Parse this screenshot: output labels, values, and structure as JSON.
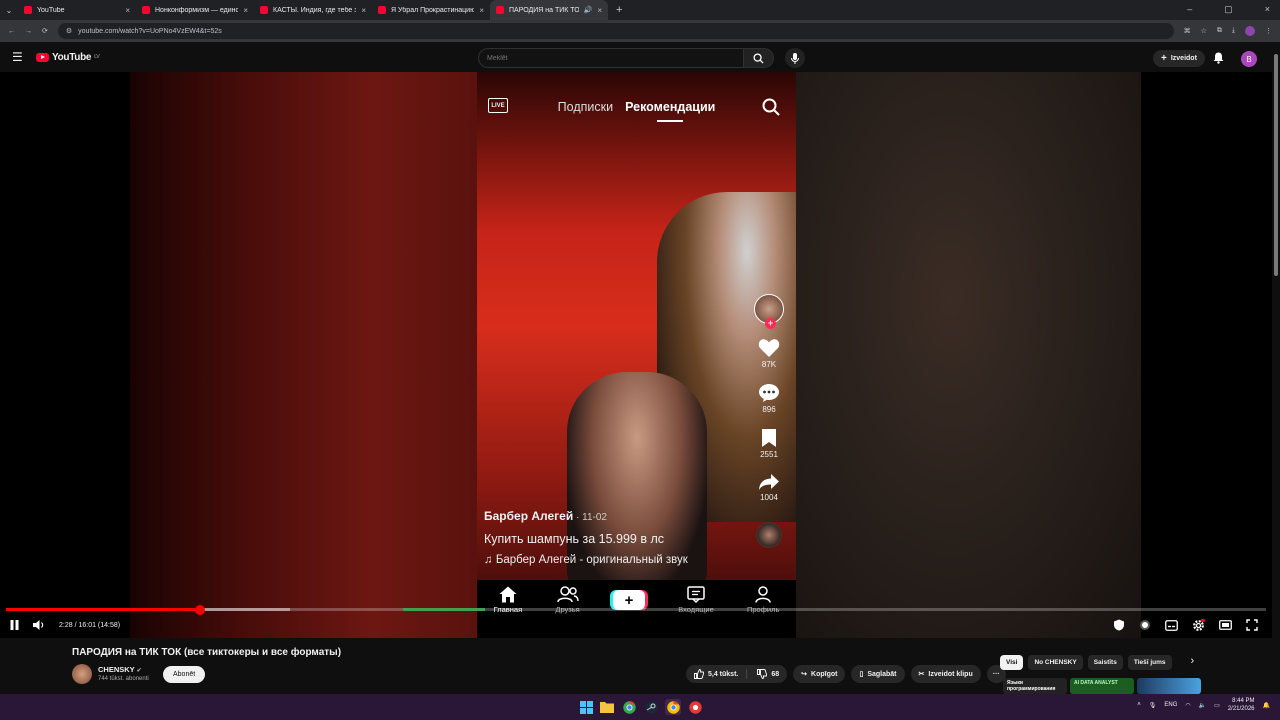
{
  "browser": {
    "tabs": [
      {
        "title": "YouTube",
        "close": "×"
      },
      {
        "title": "Нонконформизм — единств",
        "close": "×"
      },
      {
        "title": "КАСТЫ. Индия, где тебе запре",
        "close": "×"
      },
      {
        "title": "Я Убрал Прокрастинацию На",
        "close": "×"
      },
      {
        "title": "ПАРОДИЯ на ТИК ТОК (в",
        "close": "×"
      }
    ],
    "new_tab": "+",
    "url": "youtube.com/watch?v=UoPNo4VzEW4&t=52s",
    "window_controls": [
      "–",
      "▢",
      "×"
    ]
  },
  "youtube": {
    "logo_text": "YouTube",
    "region": "LV",
    "search_placeholder": "Meklēt",
    "create_label": "Izveidot",
    "avatar_letter": "B"
  },
  "tiktok": {
    "live": "LIVE",
    "tab_following": "Подписки",
    "tab_foryou": "Рекомендации",
    "likes": "87K",
    "comments": "896",
    "saves": "2551",
    "shares": "1004",
    "author": "Барбер Алегей",
    "date": " · 11-02",
    "caption": "Купить шампунь за 15.999 в лс",
    "sound": "♫ Барбер Алегей - оригинальный звук",
    "nav": [
      "Главная",
      "Друзья",
      "Входящие",
      "Профиль"
    ]
  },
  "player": {
    "time": "2:28 / 16:01 (14:58)",
    "progress": 0.154,
    "buffered": 0.225
  },
  "video": {
    "title": "ПАРОДИЯ на ТИК ТОК (все тиктокеры и все форматы)",
    "channel": "CHENSKY",
    "subs": "744 tūkst. abonenti",
    "subscribe": "Abonēt",
    "likes": "5,4 tūkst.",
    "dislikes": "68",
    "share": "Kopīgot",
    "save": "Saglabāt",
    "clip": "Izveidot klipu",
    "more": "···"
  },
  "chips": [
    "Visi",
    "No CHENSKY",
    "Saistīts",
    "Tiešī jums"
  ],
  "chips_next": "›",
  "rec_thumbs": [
    "Языки программирования",
    "AI DATA ANALYST",
    ""
  ],
  "tray": {
    "lang": "ENG",
    "time": "8:44 PM",
    "date": "2/21/2026"
  },
  "colors": {
    "yt_red": "#ff0033",
    "tiktok_pink": "#fe2c55",
    "tiktok_cyan": "#25f4ee",
    "taskbar": "#2a1637"
  }
}
